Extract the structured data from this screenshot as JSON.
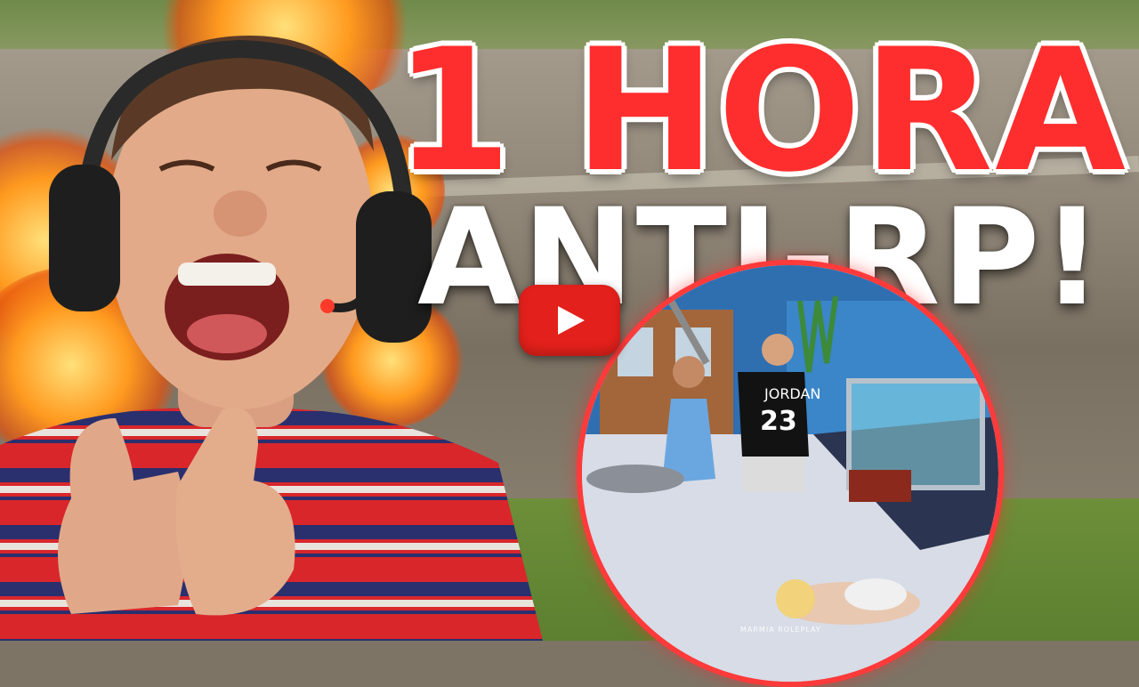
{
  "thumbnail": {
    "headline_line1": "1 HORA",
    "headline_line2": "ANTI-RP!",
    "jersey_text": "JORDAN",
    "jersey_number": "23",
    "watermark": "MARMIA ROLEPLAY",
    "play_button_icon": "youtube-play-icon"
  },
  "colors": {
    "headline_red": "#ff2e2e",
    "headline_white": "#ffffff",
    "circle_border": "#ff3a3a",
    "youtube_red": "#e3201b"
  }
}
